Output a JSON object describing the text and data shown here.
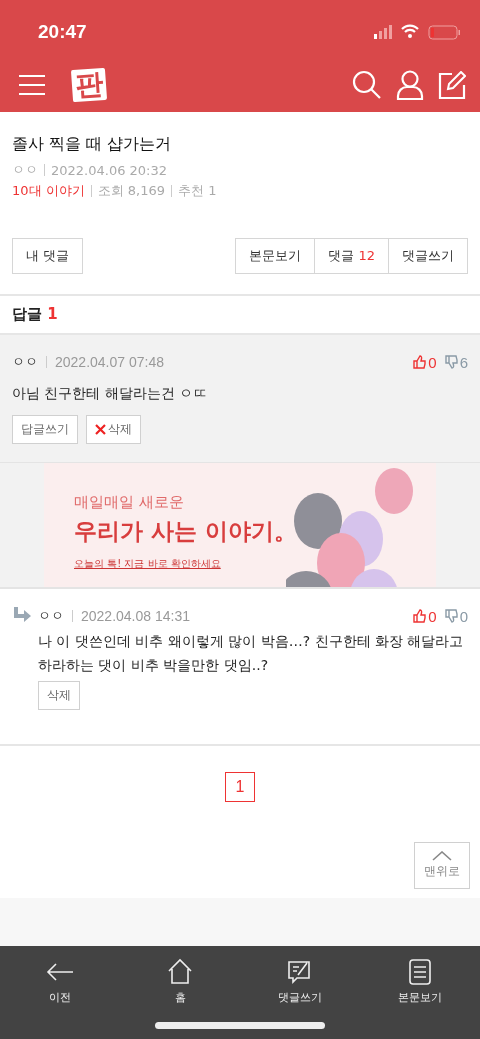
{
  "status_bar": {
    "time": "20:47"
  },
  "header": {
    "logo": "판"
  },
  "post": {
    "title": "졸사 찍을 때 샵가는거",
    "author": "ㅇㅇ",
    "date": "2022.04.06 20:32",
    "category": "10대 이야기",
    "views": "조회 8,169",
    "recommend": "추천 1"
  },
  "actions": {
    "left": "내 댓글",
    "right": [
      {
        "label": "본문보기"
      },
      {
        "label": "댓글",
        "count": "12"
      },
      {
        "label": "댓글쓰기"
      }
    ]
  },
  "replies_header": {
    "label": "답글",
    "count": "1"
  },
  "comments": [
    {
      "kind": "comment",
      "author": "ㅇㅇ",
      "date": "2022.04.07 07:48",
      "likes": "0",
      "dislikes": "6",
      "text": "아님 친구한테 해달라는건 ㅇㄸ",
      "buttons": [
        {
          "label": "답글쓰기",
          "kind": "plain"
        },
        {
          "label": "삭제",
          "kind": "delete"
        }
      ]
    },
    {
      "kind": "ad",
      "line1": "매일매일 새로운",
      "line2": "우리가 사는 이야기。",
      "line3": "오늘의 톡! 지금 바로 확인하세요"
    },
    {
      "kind": "reply",
      "author": "ㅇㅇ",
      "date": "2022.04.08 14:31",
      "likes": "0",
      "dislikes": "0",
      "text": "나 이 댓쓴인데 비추 왜이렇게 많이 박음…? 친구한테 화장 해달라고 하라하는 댓이 비추 박을만한 댓임..?",
      "buttons": [
        {
          "label": "삭제",
          "kind": "plain"
        }
      ]
    }
  ],
  "pagination": [
    {
      "label": "1",
      "selected": true
    }
  ],
  "to_top": "맨위로",
  "bottom_nav": [
    {
      "label": "이전"
    },
    {
      "label": "홈"
    },
    {
      "label": "댓글쓰기"
    },
    {
      "label": "본문보기"
    }
  ]
}
